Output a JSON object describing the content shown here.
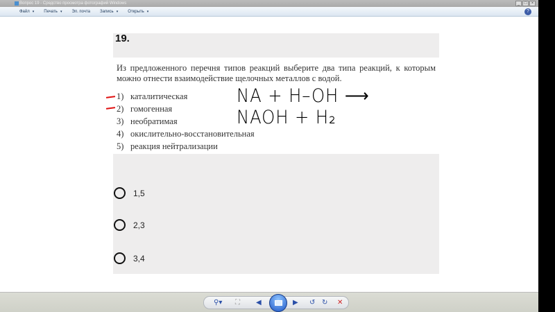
{
  "window": {
    "title": "Вопрос 19 - Средство просмотра фотографий Windows"
  },
  "menu": [
    {
      "label": "Файл"
    },
    {
      "label": "Печать"
    },
    {
      "label": "Эл. почта"
    },
    {
      "label": "Запись"
    },
    {
      "label": "Открыть"
    }
  ],
  "question": {
    "number": "19.",
    "text": "Из предложенного перечня типов реакций выберите два типа реакций, к которым можно отнести взаимодействие щелочных металлов с водой.",
    "options": [
      {
        "num": "1)",
        "label": "каталитическая"
      },
      {
        "num": "2)",
        "label": "гомогенная"
      },
      {
        "num": "3)",
        "label": "необратимая"
      },
      {
        "num": "4)",
        "label": "окислительно-восстановительная"
      },
      {
        "num": "5)",
        "label": "реакция нейтрализации"
      }
    ],
    "handwriting": "NA + H–OH ⟶ NAOH + H₂"
  },
  "answers": [
    {
      "label": "1,5"
    },
    {
      "label": "2,3"
    },
    {
      "label": "3,4"
    }
  ],
  "toolbar": {
    "zoom": "⚲▾",
    "fit": "⛶",
    "prev": "◀",
    "next": "▶",
    "rotate_ccw": "↺",
    "rotate_cw": "↻",
    "delete": "✕"
  }
}
